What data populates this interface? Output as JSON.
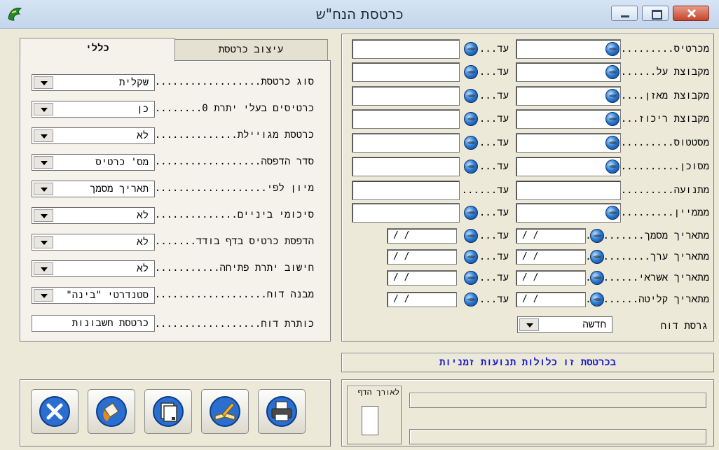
{
  "window": {
    "title": "כרטסת הנח\"ש",
    "icon": "app-logo-icon",
    "controls": [
      "minimize-icon",
      "maximize-icon",
      "close-icon"
    ],
    "close_color": "#c6442e"
  },
  "right_panel": {
    "to_label": "עד",
    "rows": [
      {
        "label": "מכרטיס",
        "from_value": "",
        "to_value": "",
        "kind": "lookup"
      },
      {
        "label": "מקבוצת על",
        "from_value": "",
        "to_value": "",
        "kind": "lookup"
      },
      {
        "label": "מקבוצת מאזן",
        "from_value": "",
        "to_value": "",
        "kind": "lookup"
      },
      {
        "label": "מקבוצת ריכוז",
        "from_value": "",
        "to_value": "",
        "kind": "lookup"
      },
      {
        "label": "מסטטוס",
        "from_value": "",
        "to_value": "",
        "kind": "lookup"
      },
      {
        "label": "מסוכן",
        "from_value": "",
        "to_value": "",
        "kind": "lookup"
      },
      {
        "label": "מתנועה",
        "from_value": "",
        "to_value": "",
        "kind": "plain"
      },
      {
        "label": "מממיין",
        "from_value": "",
        "to_value": "",
        "kind": "lookup"
      },
      {
        "label": "מתאריך מסמך",
        "from_value": "/ /",
        "to_value": "/ /",
        "kind": "date"
      },
      {
        "label": "מתאריך ערך",
        "from_value": "/ /",
        "to_value": "/ /",
        "kind": "date"
      },
      {
        "label": "מתאריך אשראי",
        "from_value": "/ /",
        "to_value": "/ /",
        "kind": "date"
      },
      {
        "label": "מתאריך קליטה",
        "from_value": "/ /",
        "to_value": "/ /",
        "kind": "date"
      }
    ],
    "report_version": {
      "label": "גרסת דוח",
      "value": "חדשה"
    }
  },
  "left_panel": {
    "tabs": [
      {
        "label": "כללי",
        "active": true
      },
      {
        "label": "עיצוב כרטסת",
        "active": false
      }
    ],
    "options": [
      {
        "label": "סוג כרטסת",
        "value": "שקלית"
      },
      {
        "label": "כרטיסים בעלי יתרת 0",
        "value": "כן"
      },
      {
        "label": "כרטסת מגויילת",
        "value": "לא"
      },
      {
        "label": "סדר הדפסה",
        "value": "מס' כרטיס"
      },
      {
        "label": "מיון לפי",
        "value": "תאריך מסמך"
      },
      {
        "label": "סיכומי ביניים",
        "value": "לא"
      },
      {
        "label": "הדפסת כרטיס בדף בודד",
        "value": "לא"
      },
      {
        "label": "חישוב יתרת פתיחה",
        "value": "לא"
      },
      {
        "label": "מבנה דוח",
        "value": "סטנדרטי \"בינה\""
      }
    ],
    "report_title": {
      "label": "כותרת דוח",
      "value": "כרטסת חשבונות"
    }
  },
  "notice": {
    "text": "בכרטסת זו כלולות תנועות זמניות",
    "color": "#1a1ad0"
  },
  "page_width_box": {
    "label": "לאורך הדף"
  },
  "toolbar": {
    "buttons": [
      "close-circle-icon",
      "paint-bucket-icon",
      "copy-pages-icon",
      "edit-book-icon",
      "printer-icon"
    ]
  },
  "colors": {
    "window_bg": "#ece9d8",
    "titlebar": "#c4d6ec",
    "globe": "#2f7fd6"
  }
}
